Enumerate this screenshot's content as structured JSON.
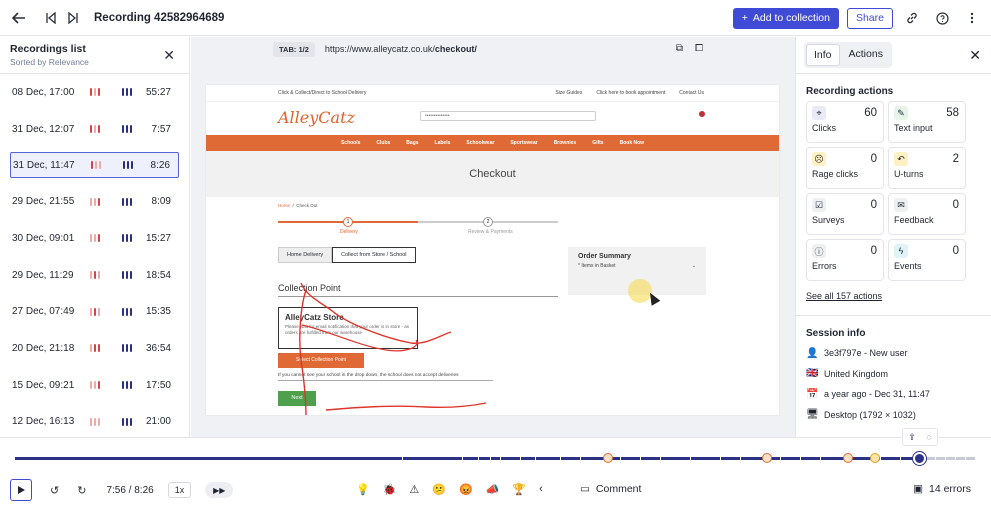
{
  "header": {
    "title": "Recording 42582964689",
    "add_label": "Add to collection",
    "share_label": "Share"
  },
  "recordings": {
    "title": "Recordings list",
    "subtitle": "Sorted by Relevance",
    "items": [
      {
        "date": "08 Dec, 17:00",
        "duration": "55:27"
      },
      {
        "date": "31 Dec, 12:07",
        "duration": "7:57"
      },
      {
        "date": "31 Dec, 11:47",
        "duration": "8:26"
      },
      {
        "date": "29 Dec, 21:55",
        "duration": "8:09"
      },
      {
        "date": "30 Dec, 09:01",
        "duration": "15:27"
      },
      {
        "date": "29 Dec, 11:29",
        "duration": "18:54"
      },
      {
        "date": "27 Dec, 07:49",
        "duration": "15:35"
      },
      {
        "date": "20 Dec, 21:18",
        "duration": "36:54"
      },
      {
        "date": "15 Dec, 09:21",
        "duration": "17:50"
      },
      {
        "date": "12 Dec, 16:13",
        "duration": "21:00"
      }
    ]
  },
  "viewer": {
    "tab": "TAB: 1/2",
    "url_base": "https://www.alleycatz.co.uk/",
    "url_path": "checkout/"
  },
  "site": {
    "top_left": "Click & Collect/Direct to School Delivery",
    "top_links": [
      "Size Guides",
      "Click here to book appointment",
      "Contact Us"
    ],
    "logo": "AlleyCatz",
    "search_placeholder": "••••••••••••••",
    "nav": [
      "Schools",
      "Clubs",
      "Bags",
      "Labels",
      "Schoolwear",
      "Sportswear",
      "Brownies",
      "Gifts",
      "Book Now"
    ],
    "checkout_title": "Checkout",
    "breadcrumb_home": "Home",
    "breadcrumb_current": "Check Out",
    "step1": "Delivery",
    "step2": "Review & Payments",
    "step1_num": "1",
    "step2_num": "2",
    "tab_home": "Home Delivery",
    "tab_collect": "Collect from Store / School",
    "collection_heading": "Collection Point",
    "store_title": "AlleyCatz Store",
    "store_desc": "Please wait for email notification that your order is in store - as orders are fulfilled from our warehouse",
    "select_btn": "Select Collection Point",
    "note": "If you cannot see your school in the drop down, the school does not accept deliveries",
    "next_btn": "Next",
    "summary_title": "Order Summary",
    "summary_items": "* Items in Basket"
  },
  "info_panel": {
    "tab_info": "Info",
    "tab_actions": "Actions",
    "actions_title": "Recording actions",
    "actions": [
      {
        "label": "Clicks",
        "count": "60",
        "icon": "cursor-click-icon",
        "color": "#e8eaf8"
      },
      {
        "label": "Text input",
        "count": "58",
        "icon": "text-input-icon",
        "color": "#e6f4ea"
      },
      {
        "label": "Rage clicks",
        "count": "0",
        "icon": "rage-face-icon",
        "color": "#fff1c4"
      },
      {
        "label": "U-turns",
        "count": "2",
        "icon": "u-turn-icon",
        "color": "#fff1c4"
      },
      {
        "label": "Surveys",
        "count": "0",
        "icon": "clipboard-icon",
        "color": "#eef0f3"
      },
      {
        "label": "Feedback",
        "count": "0",
        "icon": "feedback-icon",
        "color": "#eef0f3"
      },
      {
        "label": "Errors",
        "count": "0",
        "icon": "error-icon",
        "color": "#eef0f3"
      },
      {
        "label": "Events",
        "count": "0",
        "icon": "lightning-icon",
        "color": "#e0f3f7"
      }
    ],
    "see_all": "See all 157 actions",
    "session_title": "Session info",
    "session": [
      {
        "icon": "user-icon",
        "text": "3e3f797e - New user"
      },
      {
        "icon": "flag-icon",
        "text": "United Kingdom"
      },
      {
        "icon": "calendar-icon",
        "text": "a year ago - Dec 31, 11:47"
      },
      {
        "icon": "desktop-icon",
        "text": "Desktop (1792 × 1032)"
      }
    ]
  },
  "player": {
    "time": "7:56 / 8:26",
    "speed": "1x",
    "comment_label": "Comment",
    "errors_label": "14 errors"
  }
}
